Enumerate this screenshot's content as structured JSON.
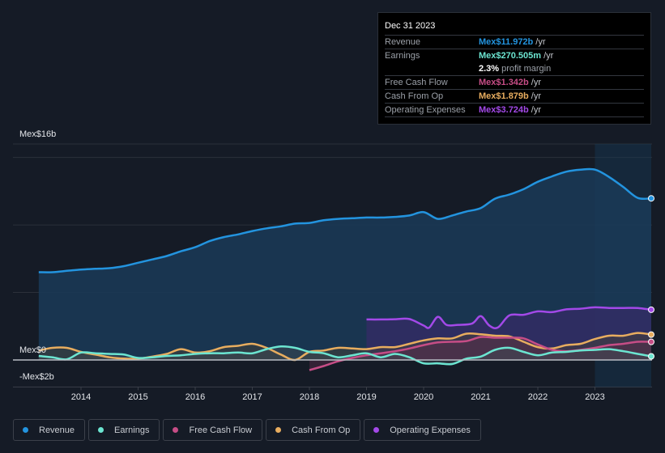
{
  "tooltip": {
    "date": "Dec 31 2023",
    "rows": [
      {
        "label": "Revenue",
        "value": "Mex$11.972b",
        "unit": "/yr",
        "color": "#2394df"
      },
      {
        "label": "Earnings",
        "value": "Mex$270.505m",
        "unit": "/yr",
        "color": "#6ce5d1"
      },
      {
        "label": "Free Cash Flow",
        "value": "Mex$1.342b",
        "unit": "/yr",
        "color": "#c64d86"
      },
      {
        "label": "Cash From Op",
        "value": "Mex$1.879b",
        "unit": "/yr",
        "color": "#e8ad5f"
      },
      {
        "label": "Operating Expenses",
        "value": "Mex$3.724b",
        "unit": "/yr",
        "color": "#a349e8"
      }
    ],
    "margin_pct": "2.3%",
    "margin_label": "profit margin"
  },
  "legend": [
    {
      "label": "Revenue",
      "color": "#2394df"
    },
    {
      "label": "Earnings",
      "color": "#6ce5d1"
    },
    {
      "label": "Free Cash Flow",
      "color": "#c64d86"
    },
    {
      "label": "Cash From Op",
      "color": "#e8ad5f"
    },
    {
      "label": "Operating Expenses",
      "color": "#a349e8"
    }
  ],
  "chart_data": {
    "type": "line",
    "title": "",
    "xlabel": "",
    "ylabel": "",
    "y_tick_labels": [
      "Mex$16b",
      "Mex$0",
      "-Mex$2b"
    ],
    "y_ticks": [
      16,
      0,
      -2
    ],
    "ylim": [
      -2,
      16
    ],
    "xlim": [
      2013.26,
      2024.0
    ],
    "x_ticks": [
      2014,
      2015,
      2016,
      2017,
      2018,
      2019,
      2020,
      2021,
      2022,
      2023
    ],
    "x_tick_labels": [
      "2014",
      "2015",
      "2016",
      "2017",
      "2018",
      "2019",
      "2020",
      "2021",
      "2022",
      "2023"
    ],
    "gridlines": [
      0,
      5,
      10,
      15,
      16
    ],
    "highlight_from": 2023.0,
    "series": [
      {
        "name": "Revenue",
        "color": "#2394df",
        "x": [
          2013.26,
          2013.5,
          2013.75,
          2014.0,
          2014.25,
          2014.5,
          2014.75,
          2015.0,
          2015.25,
          2015.5,
          2015.75,
          2016.0,
          2016.25,
          2016.5,
          2016.75,
          2017.0,
          2017.25,
          2017.5,
          2017.75,
          2018.0,
          2018.25,
          2018.5,
          2018.75,
          2019.0,
          2019.25,
          2019.5,
          2019.75,
          2020.0,
          2020.25,
          2020.5,
          2020.75,
          2021.0,
          2021.25,
          2021.5,
          2021.75,
          2022.0,
          2022.25,
          2022.5,
          2022.75,
          2023.0,
          2023.25,
          2023.5,
          2023.75,
          2024.0
        ],
        "values": [
          6.5,
          6.5,
          6.6,
          6.7,
          6.75,
          6.8,
          6.95,
          7.2,
          7.45,
          7.7,
          8.05,
          8.35,
          8.8,
          9.1,
          9.3,
          9.55,
          9.75,
          9.9,
          10.1,
          10.15,
          10.35,
          10.45,
          10.5,
          10.55,
          10.55,
          10.6,
          10.7,
          10.95,
          10.45,
          10.7,
          11.0,
          11.25,
          11.95,
          12.25,
          12.65,
          13.2,
          13.6,
          13.95,
          14.1,
          14.1,
          13.55,
          12.8,
          12.0,
          11.97
        ]
      },
      {
        "name": "Earnings",
        "color": "#6ce5d1",
        "x": [
          2013.26,
          2013.5,
          2013.75,
          2014.0,
          2014.25,
          2014.5,
          2014.75,
          2015.0,
          2015.25,
          2015.5,
          2015.75,
          2016.0,
          2016.25,
          2016.5,
          2016.75,
          2017.0,
          2017.25,
          2017.5,
          2017.75,
          2018.0,
          2018.25,
          2018.5,
          2018.75,
          2019.0,
          2019.25,
          2019.5,
          2019.75,
          2020.0,
          2020.25,
          2020.5,
          2020.75,
          2021.0,
          2021.25,
          2021.5,
          2021.75,
          2022.0,
          2022.25,
          2022.5,
          2022.75,
          2023.0,
          2023.25,
          2023.5,
          2023.75,
          2024.0
        ],
        "values": [
          0.3,
          0.2,
          0.05,
          0.55,
          0.5,
          0.45,
          0.4,
          0.15,
          0.2,
          0.3,
          0.35,
          0.45,
          0.5,
          0.5,
          0.55,
          0.5,
          0.8,
          1.0,
          0.9,
          0.6,
          0.5,
          0.2,
          0.35,
          0.5,
          0.2,
          0.45,
          0.2,
          -0.25,
          -0.25,
          -0.3,
          0.1,
          0.25,
          0.75,
          0.9,
          0.6,
          0.35,
          0.55,
          0.6,
          0.7,
          0.75,
          0.8,
          0.65,
          0.45,
          0.27
        ]
      },
      {
        "name": "Free Cash Flow",
        "color": "#c64d86",
        "x": [
          2018.0,
          2018.25,
          2018.5,
          2018.75,
          2019.0,
          2019.25,
          2019.5,
          2019.75,
          2020.0,
          2020.25,
          2020.5,
          2020.75,
          2021.0,
          2021.25,
          2021.5,
          2021.75,
          2022.0,
          2022.25,
          2022.5,
          2022.75,
          2023.0,
          2023.25,
          2023.5,
          2023.75,
          2024.0
        ],
        "values": [
          -0.75,
          -0.45,
          -0.1,
          0.15,
          0.35,
          0.5,
          0.65,
          0.85,
          1.1,
          1.3,
          1.35,
          1.4,
          1.7,
          1.65,
          1.65,
          1.6,
          1.15,
          0.75,
          0.65,
          0.75,
          0.9,
          1.1,
          1.2,
          1.35,
          1.34
        ]
      },
      {
        "name": "Cash From Op",
        "color": "#e8ad5f",
        "x": [
          2013.26,
          2013.5,
          2013.75,
          2014.0,
          2014.25,
          2014.5,
          2014.75,
          2015.0,
          2015.25,
          2015.5,
          2015.75,
          2016.0,
          2016.25,
          2016.5,
          2016.75,
          2017.0,
          2017.25,
          2017.5,
          2017.75,
          2018.0,
          2018.25,
          2018.5,
          2018.75,
          2019.0,
          2019.25,
          2019.5,
          2019.75,
          2020.0,
          2020.25,
          2020.5,
          2020.75,
          2021.0,
          2021.25,
          2021.5,
          2021.75,
          2022.0,
          2022.25,
          2022.5,
          2022.75,
          2023.0,
          2023.25,
          2023.5,
          2023.75,
          2024.0
        ],
        "values": [
          0.7,
          0.9,
          0.9,
          0.6,
          0.4,
          0.2,
          0.1,
          0.1,
          0.25,
          0.45,
          0.8,
          0.55,
          0.65,
          0.95,
          1.05,
          1.2,
          0.9,
          0.4,
          0.0,
          0.6,
          0.7,
          0.9,
          0.85,
          0.8,
          0.95,
          0.95,
          1.2,
          1.45,
          1.6,
          1.6,
          1.95,
          1.9,
          1.8,
          1.75,
          1.35,
          0.95,
          0.85,
          1.1,
          1.2,
          1.55,
          1.8,
          1.8,
          2.0,
          1.88
        ]
      },
      {
        "name": "Operating Expenses",
        "color": "#a349e8",
        "x": [
          2019.0,
          2019.25,
          2019.5,
          2019.75,
          2020.0,
          2020.1,
          2020.25,
          2020.4,
          2020.6,
          2020.85,
          2021.0,
          2021.15,
          2021.3,
          2021.5,
          2021.75,
          2022.0,
          2022.25,
          2022.5,
          2022.75,
          2023.0,
          2023.25,
          2023.5,
          2023.75,
          2024.0
        ],
        "values": [
          3.0,
          3.0,
          3.02,
          3.03,
          2.55,
          2.4,
          3.2,
          2.6,
          2.6,
          2.7,
          3.25,
          2.55,
          2.4,
          3.3,
          3.35,
          3.6,
          3.55,
          3.75,
          3.8,
          3.9,
          3.85,
          3.85,
          3.85,
          3.72
        ]
      }
    ]
  }
}
